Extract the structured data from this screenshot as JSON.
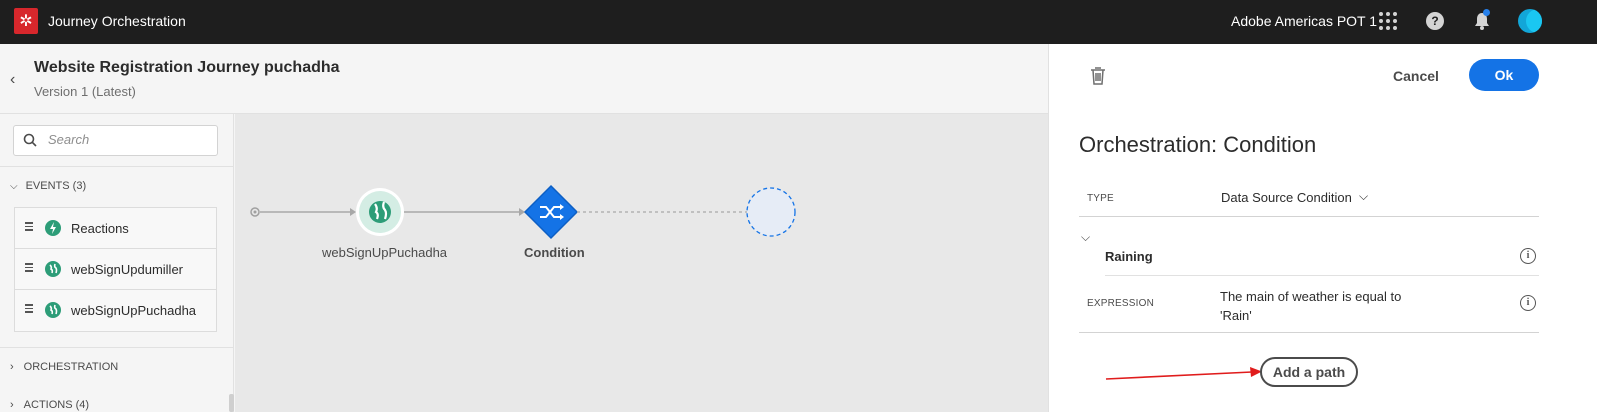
{
  "topbar": {
    "app_title": "Journey Orchestration",
    "org": "Adobe Americas POT 1",
    "icons": [
      "adobe-logo-icon",
      "apps-grid-icon",
      "help-icon",
      "bell-icon",
      "avatar"
    ]
  },
  "journey": {
    "title": "Website Registration Journey puchadha",
    "version": "Version 1 (Latest)"
  },
  "left_panel": {
    "search_placeholder": "Search",
    "sections": {
      "events": "EVENTS (3)",
      "orchestration": "ORCHESTRATION",
      "actions": "ACTIONS (4)"
    },
    "events": [
      {
        "label": "Reactions",
        "icon": "lightning-icon"
      },
      {
        "label": "webSignUpdumiller",
        "icon": "globe-icon"
      },
      {
        "label": "webSignUpPuchadha",
        "icon": "globe-icon"
      }
    ]
  },
  "canvas": {
    "nodes": [
      {
        "label": "webSignUpPuchadha",
        "type": "event",
        "icon": "globe-icon"
      },
      {
        "label": "Condition",
        "type": "condition",
        "icon": "split-arrows-icon"
      }
    ]
  },
  "properties": {
    "cancel_label": "Cancel",
    "ok_label": "Ok",
    "title": "Orchestration: Condition",
    "type_label": "TYPE",
    "type_value": "Data Source Condition",
    "path_name": "Raining",
    "expression_label": "EXPRESSION",
    "expression_value": "The main of weather is equal to 'Rain'",
    "add_path_label": "Add a path"
  },
  "colors": {
    "topbar": "#1e1e1e",
    "brand_red": "#d7272c",
    "primary_blue": "#1473e6",
    "event_green": "#2d9d78",
    "annotation_red": "#e01c1c"
  }
}
